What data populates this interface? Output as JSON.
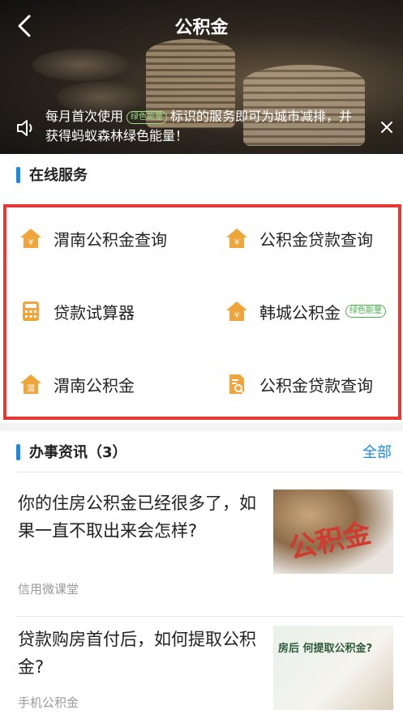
{
  "header": {
    "title": "公积金",
    "notice_line1_prefix": "每月首次使用",
    "notice_tag": "绿色能量",
    "notice_line1_suffix": "标识的服务即可为城市减排，并",
    "notice_line2": "获得蚂蚁森林绿色能量！"
  },
  "services": {
    "section_title": "在线服务",
    "items": [
      {
        "label": "渭南公积金查询",
        "icon": "house-yuan-icon"
      },
      {
        "label": "公积金贷款查询",
        "icon": "house-yuan-icon"
      },
      {
        "label": "贷款试算器",
        "icon": "calculator-icon"
      },
      {
        "label": "韩城公积金",
        "icon": "house-yuan-icon",
        "badge": "绿色能量"
      },
      {
        "label": "渭南公积金",
        "icon": "house-wei-icon"
      },
      {
        "label": "公积金贷款查询",
        "icon": "document-search-icon"
      }
    ],
    "accent_color": "#f0a53a",
    "highlight_color": "#e53935"
  },
  "news": {
    "section_title": "办事资讯（3）",
    "all_label": "全部",
    "items": [
      {
        "title": "你的住房公积金已经很多了，如果一直不取出来会怎样?",
        "source": "信用微课堂",
        "thumb_text": "公积金"
      },
      {
        "title": "贷款购房首付后，如何提取公积金?",
        "source": "手机公积金",
        "thumb_text": "房后 何提取公积金?"
      }
    ]
  },
  "colors": {
    "link": "#1e88e5",
    "green_badge": "#4caf50"
  }
}
